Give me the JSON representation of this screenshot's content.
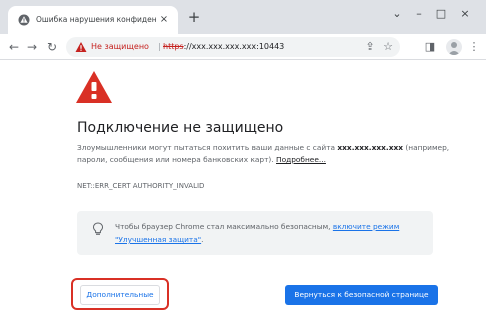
{
  "tab": {
    "title": "Ошибка нарушения конфиден",
    "close_glyph": "×",
    "new_tab_glyph": "+",
    "favicon": "warning-globe-icon"
  },
  "window_controls": {
    "dropdown": "⌄",
    "minimize": "–",
    "maximize": "□",
    "close": "×"
  },
  "toolbar": {
    "back": "←",
    "forward": "→",
    "reload": "↻",
    "security_chip": "Не защищено",
    "separator": "|",
    "url_scheme": "https",
    "url_rest": "://xxx.xxx.xxx.xxx:10443",
    "share_glyph": "⇪",
    "bookmark_glyph": "☆",
    "sidepanel_glyph": "◨",
    "menu_glyph": "⋮"
  },
  "interstitial": {
    "heading": "Подключение не защищено",
    "explanation_prefix": "Злоумышленники могут пытаться похитить ваши данные с сайта ",
    "host": "xxx.xxx.xxx.xxx",
    "explanation_suffix": " (например, пароли, сообщения или номера банковских карт). ",
    "details_link": "Подробнее...",
    "error_code": "NET::ERR_CERT AUTHORITY_INVALID",
    "safe_browsing_prefix": "Чтобы браузер Chrome стал максимально безопасным, ",
    "safe_browsing_link": "включите режим \"Улучшенная защита\"",
    "safe_browsing_suffix": ".",
    "advanced_button": "Дополнительные",
    "back_button": "Вернуться к безопасной странице"
  },
  "colors": {
    "warning_red": "#d93025",
    "primary_blue": "#1a73e8",
    "tabstrip": "#dee1e6",
    "highlight_outline": "#d93025"
  }
}
